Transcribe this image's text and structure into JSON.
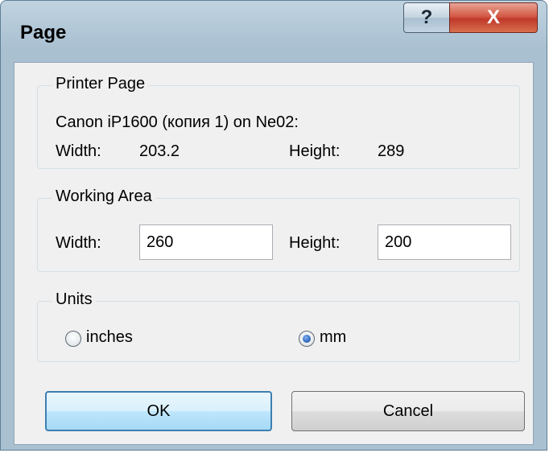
{
  "window": {
    "title": "Page"
  },
  "titlebar": {
    "help_label": "?",
    "close_label": "X"
  },
  "printer_page": {
    "title": "Printer Page",
    "printer": "Canon iP1600 (копия 1) on Ne02:",
    "width_label": "Width:",
    "width_value": "203.2",
    "height_label": "Height:",
    "height_value": "289"
  },
  "working_area": {
    "title": "Working Area",
    "width_label": "Width:",
    "width_value": "260",
    "height_label": "Height:",
    "height_value": "200"
  },
  "units": {
    "title": "Units",
    "options": [
      {
        "label": "inches",
        "checked": false
      },
      {
        "label": "mm",
        "checked": true
      }
    ]
  },
  "buttons": {
    "ok": "OK",
    "cancel": "Cancel"
  }
}
